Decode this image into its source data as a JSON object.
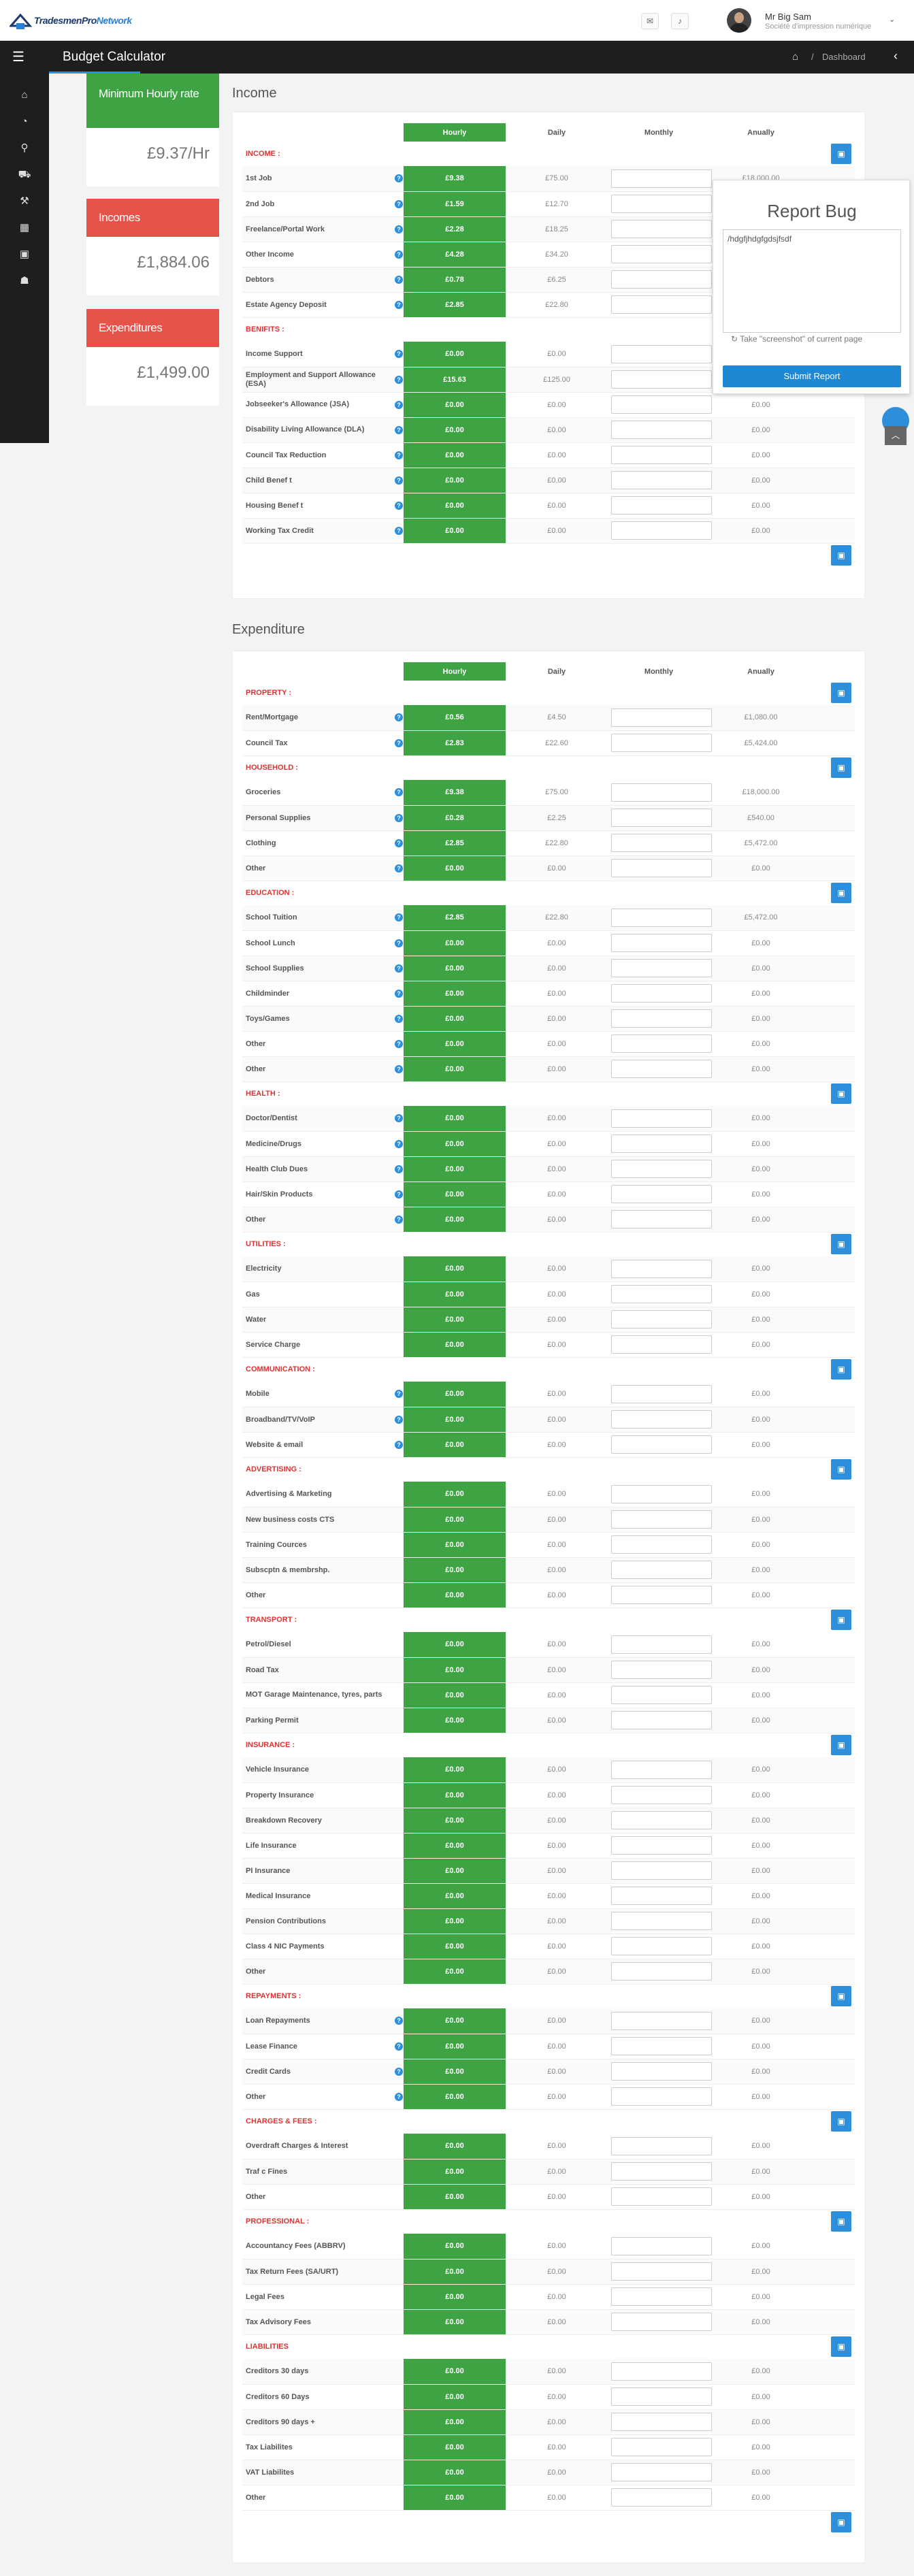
{
  "topbar": {
    "logo_a": "TradesmenPro",
    "logo_b": "Network",
    "mail_icon": "mail-icon",
    "bell_icon": "bell-icon",
    "user_name": "Mr Big Sam",
    "user_company": "Société d'impression numérique",
    "caret": "⌄"
  },
  "header": {
    "title": "Budget Calculator",
    "breadcrumb_sep": "/",
    "breadcrumb": "Dashboard"
  },
  "sidebar": {
    "items": [
      {
        "icon": "home-icon",
        "glyph": "⌂"
      },
      {
        "icon": "dashboard-icon",
        "glyph": "◔"
      },
      {
        "icon": "map-marker-icon",
        "glyph": "⚲"
      },
      {
        "icon": "truck-icon",
        "glyph": "⛟"
      },
      {
        "icon": "wrench-icon",
        "glyph": "⚒"
      },
      {
        "icon": "calendar-icon",
        "glyph": "▦"
      },
      {
        "icon": "money-icon",
        "glyph": "▣"
      },
      {
        "icon": "user-icon",
        "glyph": "☗"
      }
    ]
  },
  "stats": [
    {
      "label": "Minimum Hourly rate",
      "value": "£9.37/Hr",
      "color": "#3ea343"
    },
    {
      "label": "Incomes",
      "value": "£1,884.06",
      "color": "#e5534b"
    },
    {
      "label": "Expenditures",
      "value": "£1,499.00",
      "color": "#e5534b"
    }
  ],
  "columns": {
    "hourly": "Hourly",
    "daily": "Daily",
    "monthly": "Monthly",
    "annually": "Anually"
  },
  "income": {
    "title": "Income",
    "groups": [
      {
        "name": "INCOME :",
        "items": [
          {
            "label": "1st Job",
            "help": true,
            "hourly": "£9.38",
            "daily": "£75.00",
            "annually": "£18,000.00"
          },
          {
            "label": "2nd Job",
            "help": true,
            "hourly": "£1.59",
            "daily": "£12.70",
            "annually": ""
          },
          {
            "label": "Freelance/Portal Work",
            "help": true,
            "hourly": "£2.28",
            "daily": "£18.25",
            "annually": ""
          },
          {
            "label": "Other Income",
            "help": true,
            "hourly": "£4.28",
            "daily": "£34.20",
            "annually": ""
          },
          {
            "label": "Debtors",
            "help": true,
            "hourly": "£0.78",
            "daily": "£6.25",
            "annually": ""
          },
          {
            "label": "Estate Agency Deposit",
            "help": true,
            "hourly": "£2.85",
            "daily": "£22.80",
            "annually": ""
          }
        ]
      },
      {
        "name": "BENIFITS :",
        "items": [
          {
            "label": "Income Support",
            "help": true,
            "hourly": "£0.00",
            "daily": "£0.00",
            "annually": ""
          },
          {
            "label": "Employment and Support Allowance (ESA)",
            "help": true,
            "hourly": "£15.63",
            "daily": "£125.00",
            "annually": ""
          },
          {
            "label": "Jobseeker's Allowance (JSA)",
            "help": true,
            "hourly": "£0.00",
            "daily": "£0.00",
            "annually": "£0.00"
          },
          {
            "label": "Disability Living Allowance (DLA)",
            "help": true,
            "hourly": "£0.00",
            "daily": "£0.00",
            "annually": "£0.00"
          },
          {
            "label": "Council Tax Reduction",
            "help": true,
            "hourly": "£0.00",
            "daily": "£0.00",
            "annually": "£0.00"
          },
          {
            "label": "Child Benef t",
            "help": true,
            "hourly": "£0.00",
            "daily": "£0.00",
            "annually": "£0.00"
          },
          {
            "label": "Housing Benef t",
            "help": true,
            "hourly": "£0.00",
            "daily": "£0.00",
            "annually": "£0.00"
          },
          {
            "label": "Working Tax Credit",
            "help": true,
            "hourly": "£0.00",
            "daily": "£0.00",
            "annually": "£0.00"
          }
        ]
      }
    ]
  },
  "expenditure": {
    "title": "Expenditure",
    "groups": [
      {
        "name": "PROPERTY :",
        "items": [
          {
            "label": "Rent/Mortgage",
            "help": true,
            "hourly": "£0.56",
            "daily": "£4.50",
            "annually": "£1,080.00"
          },
          {
            "label": "Council Tax",
            "help": true,
            "hourly": "£2.83",
            "daily": "£22.60",
            "annually": "£5,424.00"
          }
        ]
      },
      {
        "name": "HOUSEHOLD :",
        "items": [
          {
            "label": "Groceries",
            "help": true,
            "hourly": "£9.38",
            "daily": "£75.00",
            "annually": "£18,000.00"
          },
          {
            "label": "Personal Supplies",
            "help": true,
            "hourly": "£0.28",
            "daily": "£2.25",
            "annually": "£540.00"
          },
          {
            "label": "Clothing",
            "help": true,
            "hourly": "£2.85",
            "daily": "£22.80",
            "annually": "£5,472.00"
          },
          {
            "label": "Other",
            "help": true,
            "hourly": "£0.00",
            "daily": "£0.00",
            "annually": "£0.00"
          }
        ]
      },
      {
        "name": "EDUCATION :",
        "items": [
          {
            "label": "School Tuition",
            "help": true,
            "hourly": "£2.85",
            "daily": "£22.80",
            "annually": "£5,472.00"
          },
          {
            "label": "School Lunch",
            "help": true,
            "hourly": "£0.00",
            "daily": "£0.00",
            "annually": "£0.00"
          },
          {
            "label": "School Supplies",
            "help": true,
            "hourly": "£0.00",
            "daily": "£0.00",
            "annually": "£0.00"
          },
          {
            "label": "Childminder",
            "help": true,
            "hourly": "£0.00",
            "daily": "£0.00",
            "annually": "£0.00"
          },
          {
            "label": "Toys/Games",
            "help": true,
            "hourly": "£0.00",
            "daily": "£0.00",
            "annually": "£0.00"
          },
          {
            "label": "Other",
            "help": true,
            "hourly": "£0.00",
            "daily": "£0.00",
            "annually": "£0.00"
          },
          {
            "label": "Other",
            "help": true,
            "hourly": "£0.00",
            "daily": "£0.00",
            "annually": "£0.00"
          }
        ]
      },
      {
        "name": "HEALTH :",
        "items": [
          {
            "label": "Doctor/Dentist",
            "help": true,
            "hourly": "£0.00",
            "daily": "£0.00",
            "annually": "£0.00"
          },
          {
            "label": "Medicine/Drugs",
            "help": true,
            "hourly": "£0.00",
            "daily": "£0.00",
            "annually": "£0.00"
          },
          {
            "label": "Health Club Dues",
            "help": true,
            "hourly": "£0.00",
            "daily": "£0.00",
            "annually": "£0.00"
          },
          {
            "label": "Hair/Skin Products",
            "help": true,
            "hourly": "£0.00",
            "daily": "£0.00",
            "annually": "£0.00"
          },
          {
            "label": "Other",
            "help": true,
            "hourly": "£0.00",
            "daily": "£0.00",
            "annually": "£0.00"
          }
        ]
      },
      {
        "name": "UTILITIES :",
        "items": [
          {
            "label": "Electricity",
            "help": false,
            "hourly": "£0.00",
            "daily": "£0.00",
            "annually": "£0.00"
          },
          {
            "label": "Gas",
            "help": false,
            "hourly": "£0.00",
            "daily": "£0.00",
            "annually": "£0.00"
          },
          {
            "label": "Water",
            "help": false,
            "hourly": "£0.00",
            "daily": "£0.00",
            "annually": "£0.00"
          },
          {
            "label": "Service Charge",
            "help": false,
            "hourly": "£0.00",
            "daily": "£0.00",
            "annually": "£0.00"
          }
        ]
      },
      {
        "name": "COMMUNICATION :",
        "items": [
          {
            "label": "Mobile",
            "help": true,
            "hourly": "£0.00",
            "daily": "£0.00",
            "annually": "£0.00"
          },
          {
            "label": "Broadband/TV/VoIP",
            "help": true,
            "hourly": "£0.00",
            "daily": "£0.00",
            "annually": "£0.00"
          },
          {
            "label": "Website & email",
            "help": true,
            "hourly": "£0.00",
            "daily": "£0.00",
            "annually": "£0.00"
          }
        ]
      },
      {
        "name": "ADVERTISING :",
        "items": [
          {
            "label": "Advertising & Marketing",
            "help": false,
            "hourly": "£0.00",
            "daily": "£0.00",
            "annually": "£0.00"
          },
          {
            "label": "New business costs CTS",
            "help": false,
            "hourly": "£0.00",
            "daily": "£0.00",
            "annually": "£0.00"
          },
          {
            "label": "Training Cources",
            "help": false,
            "hourly": "£0.00",
            "daily": "£0.00",
            "annually": "£0.00"
          },
          {
            "label": "Subscptn & membrshp.",
            "help": false,
            "hourly": "£0.00",
            "daily": "£0.00",
            "annually": "£0.00"
          },
          {
            "label": "Other",
            "help": false,
            "hourly": "£0.00",
            "daily": "£0.00",
            "annually": "£0.00"
          }
        ]
      },
      {
        "name": "TRANSPORT :",
        "items": [
          {
            "label": "Petrol/Diesel",
            "help": false,
            "hourly": "£0.00",
            "daily": "£0.00",
            "annually": "£0.00"
          },
          {
            "label": "Road Tax",
            "help": false,
            "hourly": "£0.00",
            "daily": "£0.00",
            "annually": "£0.00"
          },
          {
            "label": "MOT Garage Maintenance, tyres, parts",
            "help": false,
            "hourly": "£0.00",
            "daily": "£0.00",
            "annually": "£0.00"
          },
          {
            "label": "Parking Permit",
            "help": false,
            "hourly": "£0.00",
            "daily": "£0.00",
            "annually": "£0.00"
          }
        ]
      },
      {
        "name": "INSURANCE :",
        "items": [
          {
            "label": "Vehicle Insurance",
            "help": false,
            "hourly": "£0.00",
            "daily": "£0.00",
            "annually": "£0.00"
          },
          {
            "label": "Property Insurance",
            "help": false,
            "hourly": "£0.00",
            "daily": "£0.00",
            "annually": "£0.00"
          },
          {
            "label": "Breakdown Recovery",
            "help": false,
            "hourly": "£0.00",
            "daily": "£0.00",
            "annually": "£0.00"
          },
          {
            "label": "Life Insurance",
            "help": false,
            "hourly": "£0.00",
            "daily": "£0.00",
            "annually": "£0.00"
          },
          {
            "label": "PI Insurance",
            "help": false,
            "hourly": "£0.00",
            "daily": "£0.00",
            "annually": "£0.00"
          },
          {
            "label": "Medical Insurance",
            "help": false,
            "hourly": "£0.00",
            "daily": "£0.00",
            "annually": "£0.00"
          },
          {
            "label": "Pension Contributions",
            "help": false,
            "hourly": "£0.00",
            "daily": "£0.00",
            "annually": "£0.00"
          },
          {
            "label": "Class 4 NIC Payments",
            "help": false,
            "hourly": "£0.00",
            "daily": "£0.00",
            "annually": "£0.00"
          },
          {
            "label": "Other",
            "help": false,
            "hourly": "£0.00",
            "daily": "£0.00",
            "annually": "£0.00"
          }
        ]
      },
      {
        "name": "REPAYMENTS :",
        "items": [
          {
            "label": "Loan Repayments",
            "help": true,
            "hourly": "£0.00",
            "daily": "£0.00",
            "annually": "£0.00"
          },
          {
            "label": "Lease Finance",
            "help": true,
            "hourly": "£0.00",
            "daily": "£0.00",
            "annually": "£0.00"
          },
          {
            "label": "Credit Cards",
            "help": true,
            "hourly": "£0.00",
            "daily": "£0.00",
            "annually": "£0.00"
          },
          {
            "label": "Other",
            "help": true,
            "hourly": "£0.00",
            "daily": "£0.00",
            "annually": "£0.00"
          }
        ]
      },
      {
        "name": "CHARGES & FEES :",
        "items": [
          {
            "label": "Overdraft Charges & Interest",
            "help": false,
            "hourly": "£0.00",
            "daily": "£0.00",
            "annually": "£0.00"
          },
          {
            "label": "Traf  c Fines",
            "help": false,
            "hourly": "£0.00",
            "daily": "£0.00",
            "annually": "£0.00"
          },
          {
            "label": "Other",
            "help": false,
            "hourly": "£0.00",
            "daily": "£0.00",
            "annually": "£0.00"
          }
        ]
      },
      {
        "name": "PROFESSIONAL :",
        "items": [
          {
            "label": "Accountancy Fees (ABBRV)",
            "help": false,
            "hourly": "£0.00",
            "daily": "£0.00",
            "annually": "£0.00"
          },
          {
            "label": "Tax Return Fees (SA/URT)",
            "help": false,
            "hourly": "£0.00",
            "daily": "£0.00",
            "annually": "£0.00"
          },
          {
            "label": "Legal Fees",
            "help": false,
            "hourly": "£0.00",
            "daily": "£0.00",
            "annually": "£0.00"
          },
          {
            "label": "Tax Advisory Fees",
            "help": false,
            "hourly": "£0.00",
            "daily": "£0.00",
            "annually": "£0.00"
          }
        ]
      },
      {
        "name": "LIABILITIES",
        "items": [
          {
            "label": "Creditors 30 days",
            "help": false,
            "hourly": "£0.00",
            "daily": "£0.00",
            "annually": "£0.00"
          },
          {
            "label": "Creditors 60 Days",
            "help": false,
            "hourly": "£0.00",
            "daily": "£0.00",
            "annually": "£0.00"
          },
          {
            "label": "Creditors 90 days +",
            "help": false,
            "hourly": "£0.00",
            "daily": "£0.00",
            "annually": "£0.00"
          },
          {
            "label": "Tax Liabilites",
            "help": false,
            "hourly": "£0.00",
            "daily": "£0.00",
            "annually": "£0.00"
          },
          {
            "label": "VAT Liabilites",
            "help": false,
            "hourly": "£0.00",
            "daily": "£0.00",
            "annually": "£0.00"
          },
          {
            "label": "Other",
            "help": false,
            "hourly": "£0.00",
            "daily": "£0.00",
            "annually": "£0.00"
          }
        ]
      }
    ]
  },
  "report_bug": {
    "title": "Report Bug",
    "text": "/hdgfjhdgfgdsjfsdf",
    "screenshot_label": "Take \"screenshot\" of current page",
    "submit": "Submit Report"
  },
  "colors": {
    "accent": "#2d8fdc",
    "green": "#3ea343",
    "red": "#e5534b",
    "dark": "#1e1e1e"
  }
}
